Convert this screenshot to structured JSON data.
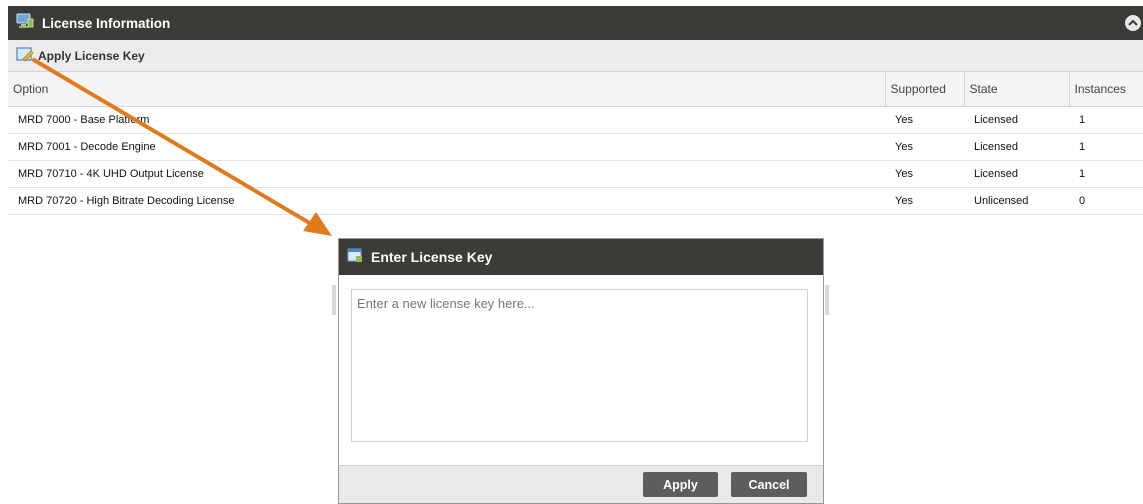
{
  "panel": {
    "title": "License Information",
    "toolbar": {
      "apply_label": "Apply License Key"
    }
  },
  "table": {
    "headers": [
      "Option",
      "Supported",
      "State",
      "Instances"
    ],
    "rows": [
      {
        "option": "MRD 7000 - Base Platform",
        "supported": "Yes",
        "state": "Licensed",
        "instances": "1"
      },
      {
        "option": "MRD 7001 - Decode Engine",
        "supported": "Yes",
        "state": "Licensed",
        "instances": "1"
      },
      {
        "option": "MRD 70710 - 4K UHD Output License",
        "supported": "Yes",
        "state": "Licensed",
        "instances": "1"
      },
      {
        "option": "MRD 70720 - High Bitrate Decoding License",
        "supported": "Yes",
        "state": "Unlicensed",
        "instances": "0"
      }
    ]
  },
  "dialog": {
    "title": "Enter License Key",
    "input_placeholder": "Enter a new license key here...",
    "apply_label": "Apply",
    "cancel_label": "Cancel"
  },
  "icons": {
    "panel_icon": "monitor-icon",
    "toolbar_icon": "edit-key-icon",
    "collapse_icon": "chevron-up-icon",
    "dialog_icon": "window-icon"
  },
  "colors": {
    "header_bg": "#3c3b37",
    "toolbar_bg": "#ececec",
    "button_bg": "#5d5d5d",
    "arrow": "#e07a1e"
  }
}
